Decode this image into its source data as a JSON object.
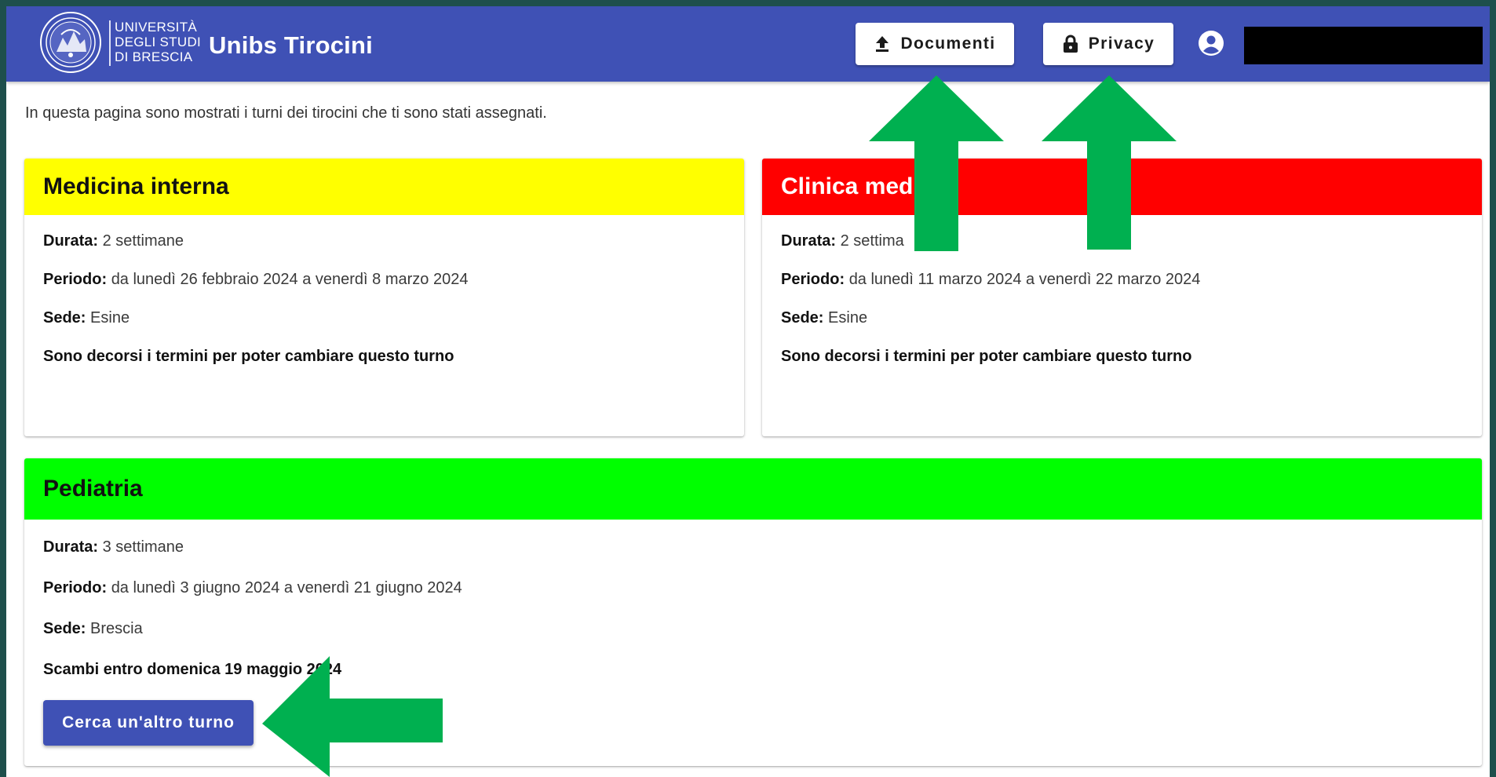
{
  "header": {
    "logo_text": [
      "UNIVERSITÀ",
      "DEGLI STUDI",
      "DI BRESCIA"
    ],
    "title": "Unibs Tirocini",
    "documenti_label": "Documenti",
    "privacy_label": "Privacy",
    "bar_color": "#3f51b5"
  },
  "intro": "In questa pagina sono mostrati i turni dei tirocini che ti sono stati assegnati.",
  "cards": [
    {
      "title": "Medicina interna",
      "color": "#ffff00",
      "durata_label": "Durata:",
      "durata": "2 settimane",
      "periodo_label": "Periodo:",
      "periodo": "da lunedì 26 febbraio 2024 a venerdì 8 marzo 2024",
      "sede_label": "Sede:",
      "sede": "Esine",
      "note": "Sono decorsi i termini per poter cambiare questo turno"
    },
    {
      "title": "Clinica medi",
      "color": "#ff0000",
      "durata_label": "Durata:",
      "durata": "2 settima",
      "periodo_label": "Periodo:",
      "periodo": "da lunedì 11 marzo 2024 a venerdì 22 marzo 2024",
      "sede_label": "Sede:",
      "sede": "Esine",
      "note": "Sono decorsi i termini per poter cambiare questo turno"
    },
    {
      "title": "Pediatria",
      "color": "#00ff00",
      "durata_label": "Durata:",
      "durata": "3 settimane",
      "periodo_label": "Periodo:",
      "periodo": "da lunedì 3 giugno 2024 a venerdì 21 giugno 2024",
      "sede_label": "Sede:",
      "sede": "Brescia",
      "note": "Scambi entro domenica 19 maggio 2024",
      "button_label": "Cerca un'altro turno"
    }
  ],
  "annotation_color": "#00b050"
}
